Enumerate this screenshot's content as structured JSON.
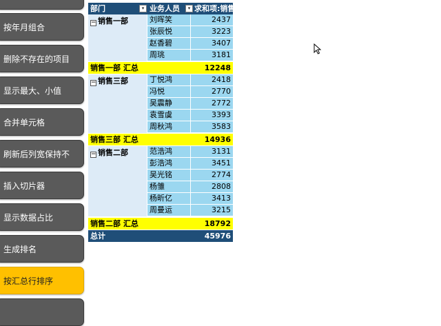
{
  "sidebar": {
    "buttons": [
      {
        "label": "",
        "active": false
      },
      {
        "label": "按年月组合",
        "active": false
      },
      {
        "label": "删除不存在的项目",
        "active": false
      },
      {
        "label": "显示最大、小值",
        "active": false
      },
      {
        "label": "合并单元格",
        "active": false
      },
      {
        "label": "刷新后列宽保持不",
        "active": false
      },
      {
        "label": "插入切片器",
        "active": false
      },
      {
        "label": "显示数据占比",
        "active": false
      },
      {
        "label": "生成排名",
        "active": false
      },
      {
        "label": "按汇总行排序",
        "active": true
      }
    ]
  },
  "pivot": {
    "headers": {
      "dept": "部门",
      "person": "业务人员",
      "sum": "求和项:销售"
    },
    "groups": [
      {
        "name": "销售一部",
        "people": [
          {
            "name": "刘晖笑",
            "value": "2437"
          },
          {
            "name": "张辰悦",
            "value": "3223"
          },
          {
            "name": "赵香碧",
            "value": "3407"
          },
          {
            "name": "周珧",
            "value": "3181"
          }
        ],
        "subtotal_label": "销售一部 汇总",
        "subtotal": "12248"
      },
      {
        "name": "销售三部",
        "people": [
          {
            "name": "丁悦鸿",
            "value": "2418"
          },
          {
            "name": "冯悦",
            "value": "2770"
          },
          {
            "name": "吴震静",
            "value": "2772"
          },
          {
            "name": "袁雪虞",
            "value": "3393"
          },
          {
            "name": "周秋鸿",
            "value": "3583"
          }
        ],
        "subtotal_label": "销售三部 汇总",
        "subtotal": "14936"
      },
      {
        "name": "销售二部",
        "people": [
          {
            "name": "范浩鸿",
            "value": "3131"
          },
          {
            "name": "彭浩鸿",
            "value": "3451"
          },
          {
            "name": "吴光铭",
            "value": "2774"
          },
          {
            "name": "杨雏",
            "value": "2808"
          },
          {
            "name": "杨昕亿",
            "value": "3413"
          },
          {
            "name": "周曼运",
            "value": "3215"
          }
        ],
        "subtotal_label": "销售二部 汇总",
        "subtotal": "18792"
      }
    ],
    "grand_total_label": "总计",
    "grand_total": "45976"
  },
  "colors": {
    "header": "#1f4e78",
    "group_fill": "#ddebf7",
    "row_fill": "#9bd7f0",
    "subtotal_fill": "#ffff00",
    "button": "#5a5a5a",
    "button_active": "#ffc000"
  }
}
